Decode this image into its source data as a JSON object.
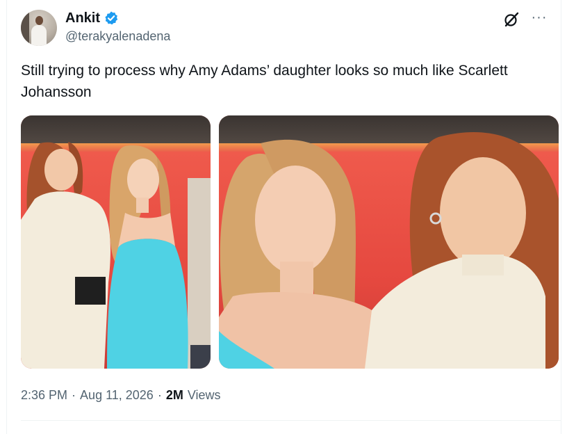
{
  "author": {
    "name": "Ankit",
    "handle": "@terakyalenadena",
    "verified": true
  },
  "icons": {
    "verified": "verified-badge-icon",
    "grok": "grok-icon",
    "more": "more-options-icon"
  },
  "colors": {
    "verified_blue": "#1d9bf0",
    "text_primary": "#0f1419",
    "text_secondary": "#536471"
  },
  "tweet": {
    "text": "Still trying to process why Amy Adams’ daughter looks so much like Scarlett Johansson"
  },
  "media": [
    {
      "name": "photo-left"
    },
    {
      "name": "photo-right"
    }
  ],
  "meta": {
    "time": "2:36 PM",
    "date": "Aug 11, 2026",
    "views_count": "2M",
    "views_label": "Views",
    "separator": "·"
  },
  "more_glyph": "···"
}
